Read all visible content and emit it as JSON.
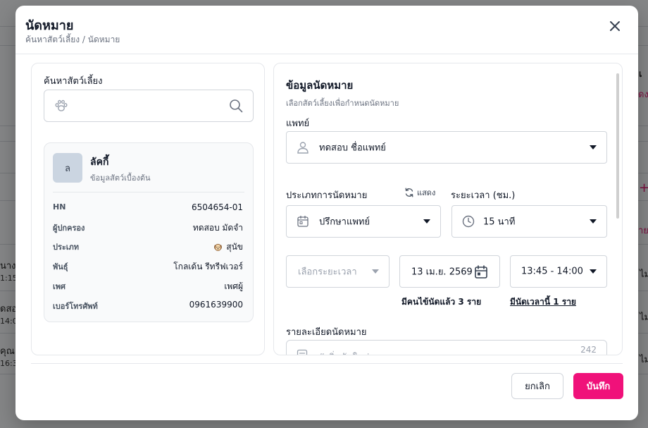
{
  "colors": {
    "accent": "#f0117a",
    "overlay": "rgba(0,0,0,0.45)"
  },
  "background": {
    "fragments": [
      "เ",
      "ดง",
      "+",
      "าย",
      "ไม",
      "ไม",
      "ไม",
      "นาง",
      "1:15",
      "ดสอ",
      "14:0",
      "คุณ",
      "16:30"
    ]
  },
  "modal": {
    "title": "นัดหมาย",
    "breadcrumb": "ค้นหาสัตว์เลี้ยง / นัดหมาย",
    "close_icon": "close-icon"
  },
  "left": {
    "search_label": "ค้นหาสัตว์เลี้ยง",
    "search_value": "",
    "pet": {
      "avatar_letter": "ล",
      "name": "ลัคกี้",
      "subtitle": "ข้อมูลสัตว์เบื้องต้น",
      "species_icon": "dog-face-icon",
      "rows": [
        {
          "label": "HN",
          "value": "6504654-01"
        },
        {
          "label": "ผู้ปกครอง",
          "value": "ทดสอบ มัดจำ"
        },
        {
          "label": "ประเภท",
          "value": "สุนัข"
        },
        {
          "label": "พันธุ์",
          "value": "โกลเด้น รีทรีฟเวอร์"
        },
        {
          "label": "เพศ",
          "value": "เพศผู้"
        },
        {
          "label": "เบอร์โทรศัพท์",
          "value": "0961639900"
        }
      ]
    }
  },
  "right": {
    "title": "ข้อมูลนัดหมาย",
    "subtitle": "เลือกสัตว์เลี้ยงเพื่อกำหนดนัดหมาย",
    "doctor_label": "แพทย์",
    "doctor_value": "ทดสอบ ชื่อแพทย์",
    "type_label": "ประเภทการนัดหมาย",
    "show_label": "แสดง",
    "type_value": "ปรึกษาแพทย์",
    "duration_label": "ระยะเวลา (ชม.)",
    "duration_value": "15 นาที",
    "period_placeholder": "เลือกระยะเวลา",
    "date_value": "13 เม.ย. 2569",
    "time_value": "13:45 - 14:00",
    "booked_note": "มีคนไข้นัดแล้ว 3 ราย",
    "slot_note": "มีนัดเวลานี้ 1 ราย",
    "detail_label": "รายละเอียดนัดหมาย",
    "detail_placeholder": "#เพิ่มนัดใหม่",
    "detail_count": "242"
  },
  "footer": {
    "cancel_label": "ยกเลิก",
    "save_label": "บันทึก"
  }
}
